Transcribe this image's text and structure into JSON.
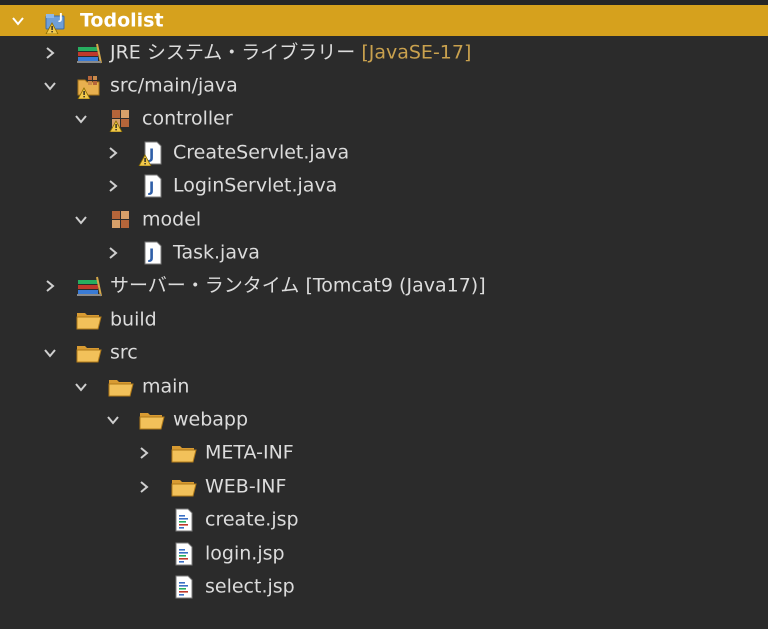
{
  "tree": {
    "root": {
      "label": "Todolist",
      "expanded": true,
      "icon": "project-warning-icon"
    },
    "items": [
      {
        "label": "JRE システム・ライブラリー",
        "decoration": "[JavaSE-17]",
        "expanded": false,
        "icon": "library-icon"
      },
      {
        "label": "src/main/java",
        "expanded": true,
        "icon": "source-folder-warning-icon"
      },
      {
        "label": "controller",
        "expanded": true,
        "icon": "package-warning-icon"
      },
      {
        "label": "CreateServlet.java",
        "expanded": false,
        "icon": "java-file-warning-icon"
      },
      {
        "label": "LoginServlet.java",
        "expanded": false,
        "icon": "java-file-icon"
      },
      {
        "label": "model",
        "expanded": true,
        "icon": "package-icon"
      },
      {
        "label": "Task.java",
        "expanded": false,
        "icon": "java-file-icon"
      },
      {
        "label": "サーバー・ランタイム [Tomcat9 (Java17)]",
        "expanded": false,
        "icon": "library-icon"
      },
      {
        "label": "build",
        "icon": "folder-open-icon"
      },
      {
        "label": "src",
        "expanded": true,
        "icon": "folder-open-icon"
      },
      {
        "label": "main",
        "expanded": true,
        "icon": "folder-open-icon"
      },
      {
        "label": "webapp",
        "expanded": true,
        "icon": "folder-open-icon"
      },
      {
        "label": "META-INF",
        "expanded": false,
        "icon": "folder-open-icon"
      },
      {
        "label": "WEB-INF",
        "expanded": false,
        "icon": "folder-open-icon"
      },
      {
        "label": "create.jsp",
        "icon": "jsp-file-icon"
      },
      {
        "label": "login.jsp",
        "icon": "jsp-file-icon"
      },
      {
        "label": "select.jsp",
        "icon": "jsp-file-icon"
      }
    ]
  },
  "colors": {
    "background": "#2b2b2b",
    "selection": "#d6a11d",
    "text": "#dcdcdc",
    "decoration": "#c9a14e"
  }
}
